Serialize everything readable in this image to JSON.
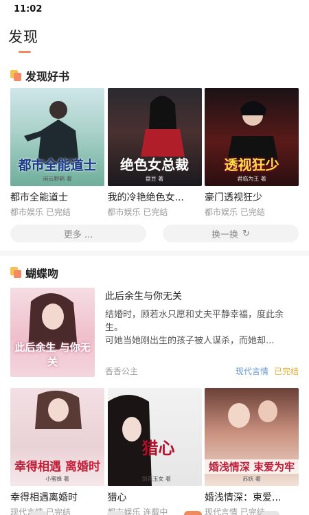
{
  "status_bar": {
    "time": "11:02"
  },
  "header": {
    "title": "发现"
  },
  "section1": {
    "title": "发现好书",
    "books": [
      {
        "title": "都市全能道士",
        "category": "都市娱乐",
        "status": "已完结",
        "cover_text": "都市全能道士",
        "cover_author": "闲云野鹤 著"
      },
      {
        "title": "我的冷艳绝色女...",
        "category": "都市娱乐",
        "status": "已完结",
        "cover_text": "绝色女总裁",
        "cover_author": "盘豆 著"
      },
      {
        "title": "豪门透视狂少",
        "category": "都市娱乐",
        "status": "已完结",
        "cover_text": "透视狂少",
        "cover_author": "君临为王 著"
      }
    ],
    "more_label": "更多 ...",
    "refresh_label": "换一换",
    "refresh_icon": "↻"
  },
  "section2": {
    "title": "蝴蝶吻",
    "feature": {
      "title": "此后余生与你无关",
      "description": "结婚时，顾若水只愿和丈夫平静幸福，度此余生。\n可她当她刚出生的孩子被人谋杀，而她却...",
      "author": "香香公主",
      "category": "现代言情",
      "status": "已完结",
      "cover_text": "此后余生 与你无关"
    },
    "books": [
      {
        "title": "幸得相遇离婚时",
        "category": "现代言情",
        "status": "已完结",
        "cover_text": "幸得相遇 离婚时",
        "cover_author": "小蜜蜂 著"
      },
      {
        "title": "猎心",
        "category": "都市娱乐",
        "status": "连载中",
        "cover_text": "猎心",
        "cover_author": "剑花玉女 著"
      },
      {
        "title": "婚浅情深：束爱...",
        "category": "现代言情",
        "status": "已完结",
        "cover_text": "婚浅情深 束爱为牢",
        "cover_author": "苏妖 著"
      }
    ]
  },
  "colors": {
    "accent": "#f08a5d",
    "category_blue": "#6a9bd8",
    "status_gold": "#e4b13a"
  }
}
